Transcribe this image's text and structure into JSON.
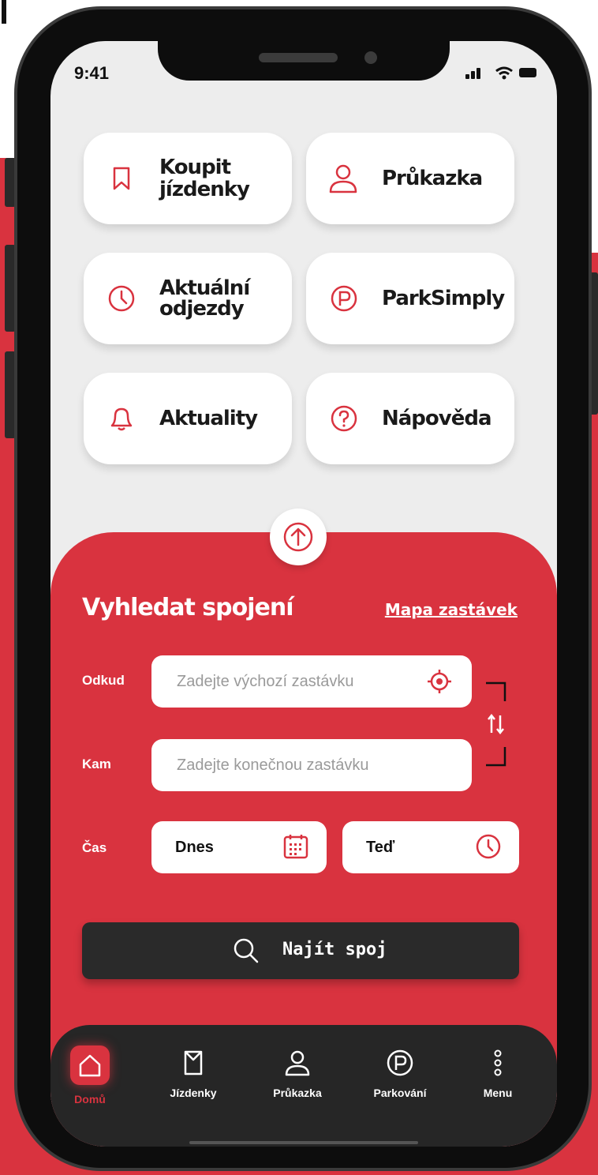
{
  "status_bar": {
    "time": "9:41"
  },
  "tiles": [
    {
      "label": "Koupit\njízdenky",
      "icon": "bookmark-icon"
    },
    {
      "label": "Průkazka",
      "icon": "person-icon"
    },
    {
      "label": "Aktuální\nodjezdy",
      "icon": "clock-icon"
    },
    {
      "label": "ParkSimply",
      "icon": "parking-icon"
    },
    {
      "label": "Aktuality",
      "icon": "bell-icon"
    },
    {
      "label": "Nápověda",
      "icon": "help-icon"
    }
  ],
  "search": {
    "title": "Vyhledat spojení",
    "map_link": "Mapa zastávek",
    "from_label": "Odkud",
    "from_placeholder": "Zadejte výchozí zastávku",
    "to_label": "Kam",
    "to_placeholder": "Zadejte konečnou zastávku",
    "time_label": "Čas",
    "date_value": "Dnes",
    "time_value": "Teď",
    "find_button": "Najít spoj"
  },
  "nav": [
    {
      "label": "Domů",
      "icon": "home-icon",
      "active": true
    },
    {
      "label": "Jízdenky",
      "icon": "ticket-icon"
    },
    {
      "label": "Průkazka",
      "icon": "person-icon"
    },
    {
      "label": "Parkování",
      "icon": "parking-icon"
    },
    {
      "label": "Menu",
      "icon": "more-vertical-icon"
    }
  ],
  "colors": {
    "accent": "#d9333f",
    "dark": "#262626",
    "screen_bg": "#ededed"
  }
}
